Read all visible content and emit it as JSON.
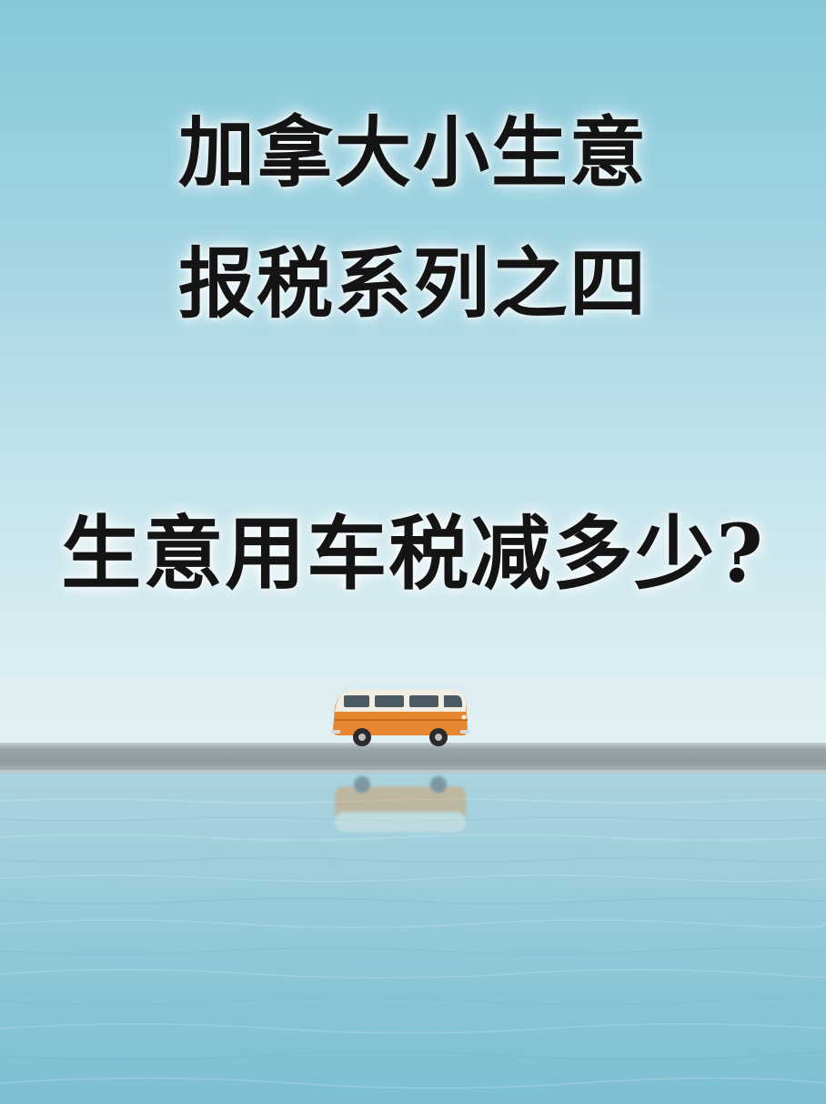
{
  "title": {
    "line1": "加拿大小生意",
    "line2": "报税系列之四",
    "question": "生意用车税减多少?"
  },
  "scene": {
    "sky_color": "#9fd3e1",
    "water_color": "#8cc6d7",
    "van_color": "#e8862f",
    "subject": "van-icon"
  }
}
